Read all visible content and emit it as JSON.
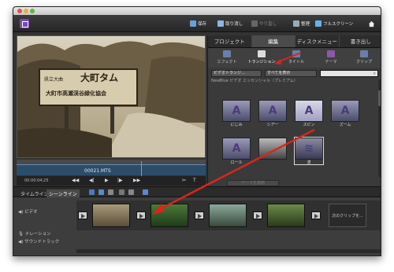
{
  "toolbar": {
    "save": "保存",
    "undo": "取り消し",
    "redo": "やり直し",
    "organize": "整理",
    "fullscreen": "フルスクリーン"
  },
  "panel": {
    "tabs": [
      {
        "label": "プロジェクト"
      },
      {
        "label": "編集"
      },
      {
        "label": "ディスクメニュー"
      },
      {
        "label": "書き出し"
      }
    ],
    "subtabs": [
      {
        "label": "エフェクト"
      },
      {
        "label": "トランジション"
      },
      {
        "label": "タイトル"
      },
      {
        "label": "テーマ"
      },
      {
        "label": "クリップ"
      }
    ],
    "filter_category": "ビデオトランジ...",
    "filter_show": "すべてを表示",
    "category_label": "NewBlue ビデオ エッセンシャル（プレミアム）",
    "transitions": [
      {
        "label": "にじみ"
      },
      {
        "label": "シアー"
      },
      {
        "label": "スピン"
      },
      {
        "label": "ズーム"
      },
      {
        "label": "ロール"
      },
      {
        "label": ""
      },
      {
        "label": "波"
      }
    ],
    "apply_button": "テーマを適用"
  },
  "preview": {
    "sign_line1": "県立大曲",
    "sign_big": "大町タム",
    "sign_line2": "大町市高瀬渓谷緑化協会",
    "clip_name": "00021.MTS",
    "timecode": "00:00:04;25"
  },
  "timeline": {
    "tabs": [
      {
        "label": "タイムライン"
      },
      {
        "label": "シーンライン"
      }
    ],
    "tracks": [
      {
        "label": "ビデオ"
      },
      {
        "label": "ナレーション"
      },
      {
        "label": "サウンドトラック"
      }
    ],
    "next_clip": "次のクリップを..."
  }
}
